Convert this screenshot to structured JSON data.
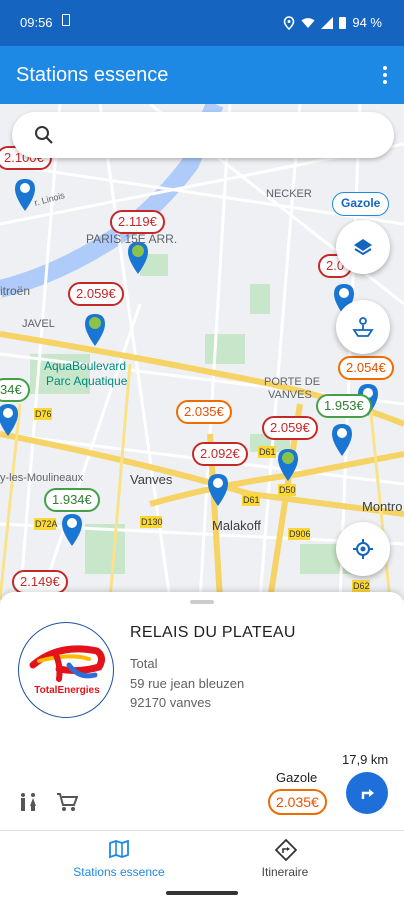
{
  "status": {
    "time": "09:56",
    "battery": "94 %"
  },
  "appbar": {
    "title": "Stations essence"
  },
  "search": {
    "placeholder": ""
  },
  "fuel_filter": "Gazole",
  "map": {
    "labels": [
      {
        "id": "necker",
        "text": "NECKER"
      },
      {
        "id": "paris15",
        "text": "PARIS 15E ARR."
      },
      {
        "id": "javel",
        "text": "JAVEL"
      },
      {
        "id": "citroen",
        "text": "itroën"
      },
      {
        "id": "aqua1",
        "text": "AquaBoulevard"
      },
      {
        "id": "aqua2",
        "text": "Parc Aquatique"
      },
      {
        "id": "vanvesporte1",
        "text": "PORTE DE"
      },
      {
        "id": "vanvesporte2",
        "text": "VANVES"
      },
      {
        "id": "vanves",
        "text": "Vanves"
      },
      {
        "id": "malakoff",
        "text": "Malakoff"
      },
      {
        "id": "issy",
        "text": "y-les-Moulineaux"
      },
      {
        "id": "montrouge",
        "text": "Montro"
      },
      {
        "id": "rue",
        "text": "r. Linois"
      }
    ],
    "roads": [
      "D76",
      "D72A",
      "D130",
      "D61",
      "D50",
      "D906",
      "D62",
      "D61"
    ],
    "price_tags": [
      {
        "text": "2.100€",
        "color": "red"
      },
      {
        "text": "2.119€",
        "color": "red"
      },
      {
        "text": "2.059€",
        "color": "red"
      },
      {
        "text": "2.0",
        "color": "red"
      },
      {
        "text": "2.054€",
        "color": "orange"
      },
      {
        "text": "34€",
        "color": "green"
      },
      {
        "text": "2.035€",
        "color": "orange"
      },
      {
        "text": "1.953€",
        "color": "green"
      },
      {
        "text": "2.059€",
        "color": "red"
      },
      {
        "text": "2.092€",
        "color": "red"
      },
      {
        "text": "1.934€",
        "color": "green"
      },
      {
        "text": "2.149€",
        "color": "red"
      }
    ]
  },
  "station": {
    "name": "RELAIS DU PLATEAU",
    "brand": "Total",
    "brand_logo_text": "TotalEnergies",
    "address": "59 rue jean bleuzen",
    "city": "92170 vanves",
    "fuel": "Gazole",
    "price": "2.035€",
    "distance": "17,9 km"
  },
  "bottom_nav": [
    {
      "label": "Stations essence",
      "active": true
    },
    {
      "label": "Itineraire",
      "active": false
    }
  ],
  "colors": {
    "primary": "#1e88e5",
    "statusbar": "#1565c0",
    "active_tab": "#1e88e5"
  }
}
